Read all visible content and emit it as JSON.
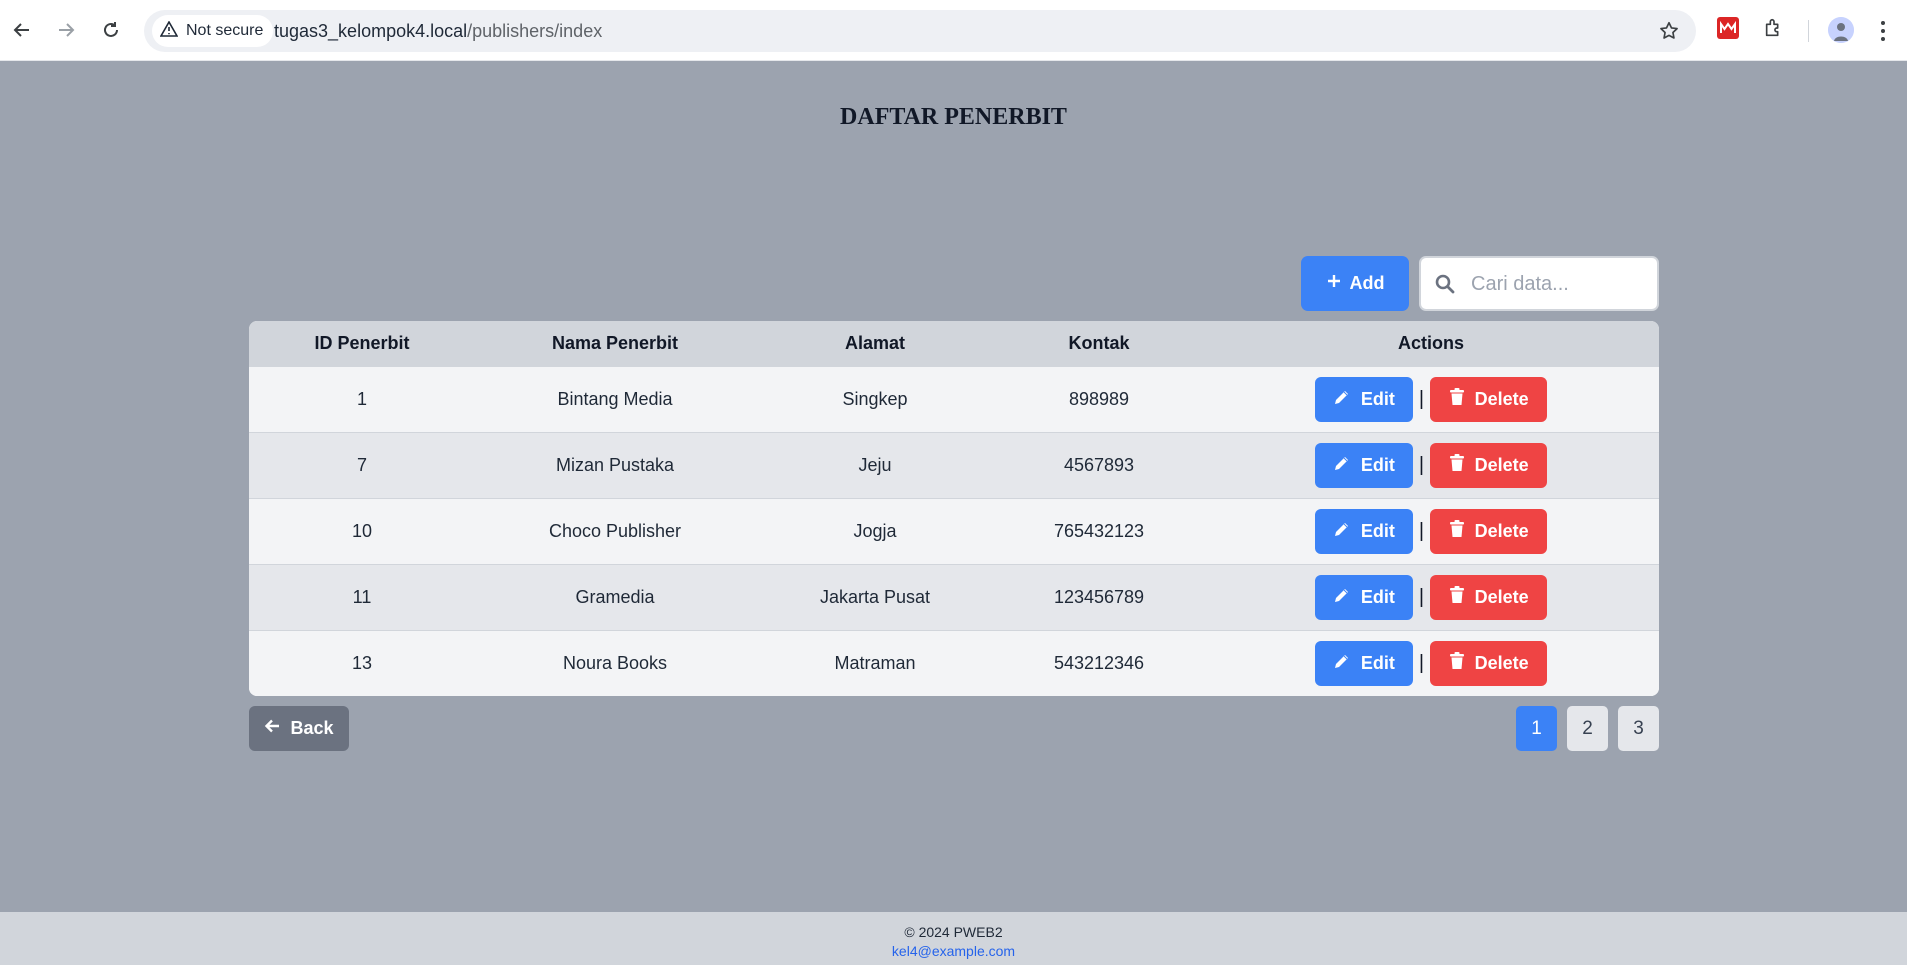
{
  "browser": {
    "security_label": "Not secure",
    "url_host": "tugas3_kelompok4.local",
    "url_path": "/publishers/index"
  },
  "page": {
    "title": "DAFTAR PENERBIT",
    "add_label": "Add",
    "search_placeholder": "Cari data...",
    "back_label": "Back"
  },
  "table": {
    "headers": [
      "ID Penerbit",
      "Nama Penerbit",
      "Alamat",
      "Kontak",
      "Actions"
    ],
    "rows": [
      {
        "id": "1",
        "nama": "Bintang Media",
        "alamat": "Singkep",
        "kontak": "898989"
      },
      {
        "id": "7",
        "nama": "Mizan Pustaka",
        "alamat": "Jeju",
        "kontak": "4567893"
      },
      {
        "id": "10",
        "nama": "Choco Publisher",
        "alamat": "Jogja",
        "kontak": "765432123"
      },
      {
        "id": "11",
        "nama": "Gramedia",
        "alamat": "Jakarta Pusat",
        "kontak": "123456789"
      },
      {
        "id": "13",
        "nama": "Noura Books",
        "alamat": "Matraman",
        "kontak": "543212346"
      }
    ],
    "edit_label": "Edit",
    "delete_label": "Delete",
    "separator": "|"
  },
  "pagination": {
    "pages": [
      "1",
      "2",
      "3"
    ],
    "active": "1"
  },
  "footer": {
    "copyright": "© 2024 PWEB2",
    "email": "kel4@example.com"
  },
  "colors": {
    "primary": "#3b82f6",
    "danger": "#ef4444",
    "secondary": "#6b7280",
    "page_bg": "#9ca3af"
  },
  "icons": [
    "back-arrow-icon",
    "forward-arrow-icon",
    "reload-icon",
    "warning-icon",
    "star-icon",
    "extension-red-icon",
    "puzzle-icon",
    "plus-icon",
    "search-icon",
    "pencil-icon",
    "trash-icon",
    "arrow-left-icon"
  ]
}
